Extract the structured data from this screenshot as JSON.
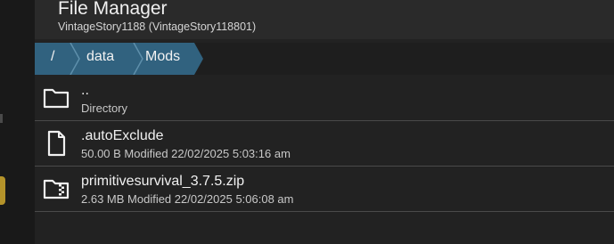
{
  "header": {
    "title": "File Manager",
    "subtitle": "VintageStory1188 (VintageStory118801)"
  },
  "breadcrumb": {
    "items": [
      "/",
      "data",
      "Mods"
    ]
  },
  "files": [
    {
      "name": "..",
      "meta": "Directory",
      "icon": "folder-icon"
    },
    {
      "name": ".autoExclude",
      "meta": "50.00 B Modified 22/02/2025 5:03:16 am",
      "icon": "file-icon"
    },
    {
      "name": "primitivesurvival_3.7.5.zip",
      "meta": "2.63 MB Modified 22/02/2025 5:06:08 am",
      "icon": "zip-file-icon"
    }
  ],
  "colors": {
    "background": "#222222",
    "header": "#2a2a2a",
    "breadcrumb_accent": "#31627f",
    "divider": "#4a4a4a"
  }
}
